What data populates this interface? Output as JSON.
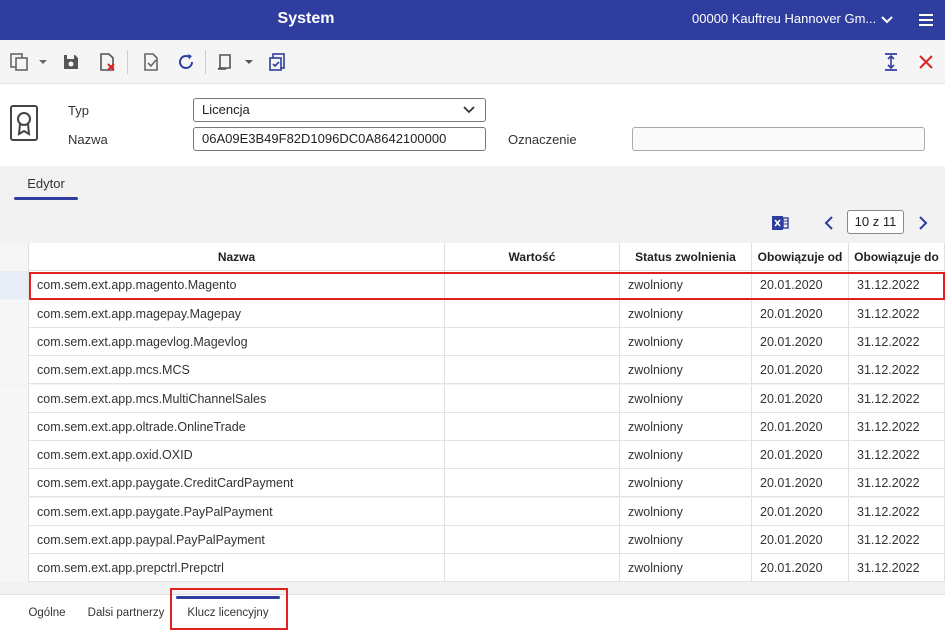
{
  "header": {
    "title": "System",
    "company": "00000  Kauftreu Hannover Gm...",
    "bg_color": "#2f3e9e"
  },
  "toolbar": {
    "icons": [
      "copy-icon",
      "save-icon",
      "discard-icon",
      "validate-icon",
      "refresh-icon",
      "print-icon",
      "document-check-icon",
      "expand-vertical-icon",
      "close-icon"
    ]
  },
  "form": {
    "typ_label": "Typ",
    "typ_value": "Licencja",
    "nazwa_label": "Nazwa",
    "nazwa_value": "06A09E3B49F82D1096DC0A8642100000",
    "oznaczenie_label": "Oznaczenie",
    "oznaczenie_value": ""
  },
  "editor": {
    "tab_label": "Edytor",
    "pager": "10 z 11"
  },
  "table": {
    "columns": [
      "Nazwa",
      "Wartość",
      "Status zwolnienia",
      "Obowiązuje od",
      "Obowiązuje do"
    ],
    "rows": [
      [
        "com.sem.ext.app.magento.Magento",
        "",
        "zwolniony",
        "20.01.2020",
        "31.12.2022"
      ],
      [
        "com.sem.ext.app.magepay.Magepay",
        "",
        "zwolniony",
        "20.01.2020",
        "31.12.2022"
      ],
      [
        "com.sem.ext.app.magevlog.Magevlog",
        "",
        "zwolniony",
        "20.01.2020",
        "31.12.2022"
      ],
      [
        "com.sem.ext.app.mcs.MCS",
        "",
        "zwolniony",
        "20.01.2020",
        "31.12.2022"
      ],
      [
        "com.sem.ext.app.mcs.MultiChannelSales",
        "",
        "zwolniony",
        "20.01.2020",
        "31.12.2022"
      ],
      [
        "com.sem.ext.app.oltrade.OnlineTrade",
        "",
        "zwolniony",
        "20.01.2020",
        "31.12.2022"
      ],
      [
        "com.sem.ext.app.oxid.OXID",
        "",
        "zwolniony",
        "20.01.2020",
        "31.12.2022"
      ],
      [
        "com.sem.ext.app.paygate.CreditCardPayment",
        "",
        "zwolniony",
        "20.01.2020",
        "31.12.2022"
      ],
      [
        "com.sem.ext.app.paygate.PayPalPayment",
        "",
        "zwolniony",
        "20.01.2020",
        "31.12.2022"
      ],
      [
        "com.sem.ext.app.paypal.PayPalPayment",
        "",
        "zwolniony",
        "20.01.2020",
        "31.12.2022"
      ],
      [
        "com.sem.ext.app.prepctrl.Prepctrl",
        "",
        "zwolniony",
        "20.01.2020",
        "31.12.2022"
      ]
    ]
  },
  "bottom_tabs": [
    "Ogólne",
    "Dalsi partnerzy",
    "Klucz licencyjny"
  ]
}
